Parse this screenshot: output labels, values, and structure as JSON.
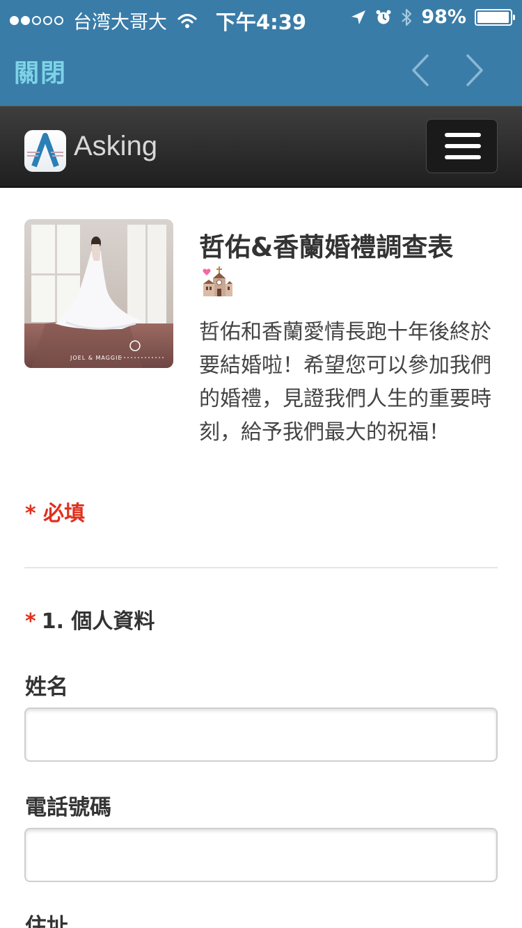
{
  "status_bar": {
    "carrier": "台湾大哥大",
    "time": "下午4:39",
    "battery": "98%",
    "battery_level": 0.98,
    "signal_bars_filled": 2,
    "signal_bars_total": 5
  },
  "browser_nav": {
    "close_label": "關閉"
  },
  "app_header": {
    "brand": "Asking"
  },
  "survey": {
    "title": "哲佑&香蘭婚禮調查表",
    "description": "哲佑和香蘭愛情長跑十年後終於要結婚啦！希望您可以參加我們的婚禮，見證我們人生的重要時刻，給予我們最大的祝福！",
    "image_caption": "JOEL & MAGGIE",
    "required_note": "* 必填"
  },
  "question_1": {
    "star": "*",
    "label": "1. 個人資料",
    "fields": [
      {
        "label": "姓名",
        "value": ""
      },
      {
        "label": "電話號碼",
        "value": ""
      },
      {
        "label": "住址",
        "value": ""
      }
    ]
  },
  "colors": {
    "nav_blue": "#3a7ca8",
    "close_link": "#7dd3e6",
    "required_red": "#e0301e",
    "header_dark": "#2b2b2b"
  }
}
